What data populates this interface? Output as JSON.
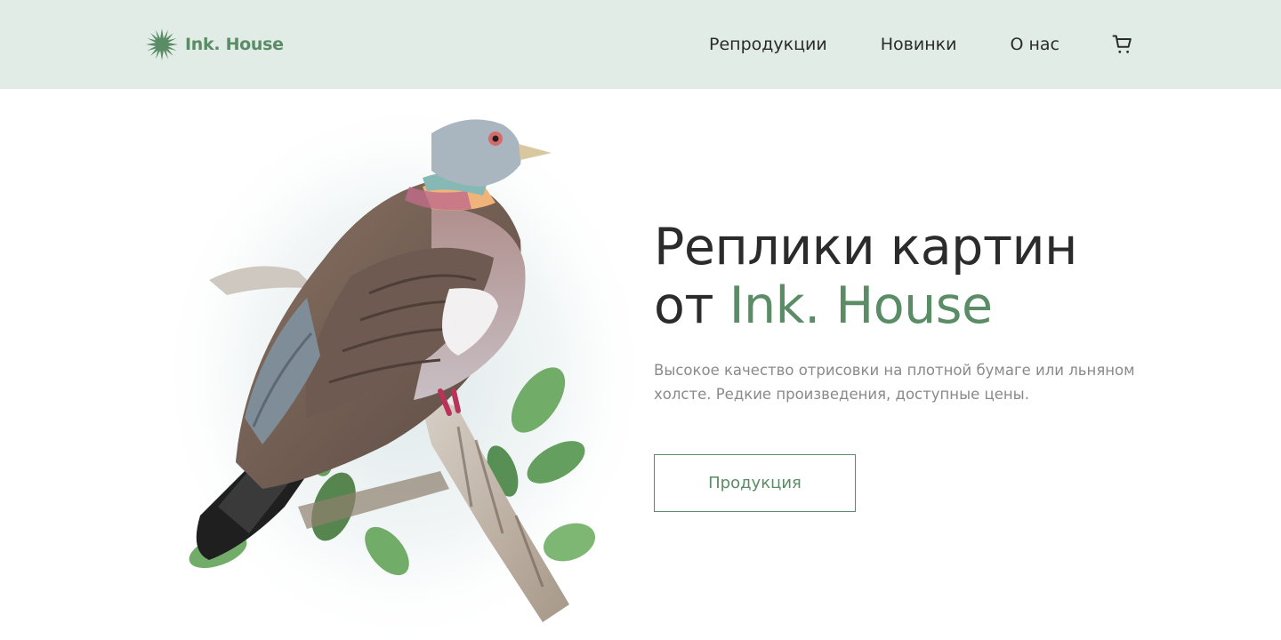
{
  "brand": {
    "name": "Ink. House",
    "accent_color": "#5a8c66",
    "header_bg": "#e2ece6",
    "logo_icon": "star-burst-icon"
  },
  "nav": {
    "items": [
      {
        "label": "Репродукции"
      },
      {
        "label": "Новинки"
      },
      {
        "label": "О нас"
      }
    ],
    "cart_icon": "cart-icon"
  },
  "hero": {
    "title_line1": "Реплики картин",
    "title_line2_prefix": "от ",
    "title_line2_accent": "Ink. House",
    "description": "Высокое качество отрисовки на плотной бумаге или льняном холсте. Редкие произведения, доступные цены.",
    "cta_label": "Продукция",
    "image_subject": "pigeon-illustration"
  }
}
